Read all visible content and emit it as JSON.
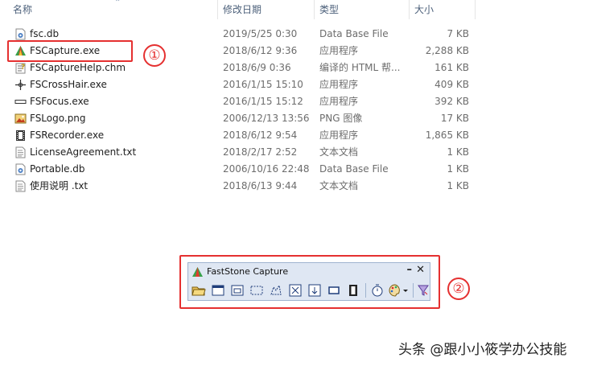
{
  "columns": {
    "name": "名称",
    "date": "修改日期",
    "type": "类型",
    "size": "大小"
  },
  "files": [
    {
      "name": "fsc.db",
      "date": "2019/5/25 0:30",
      "type": "Data Base File",
      "size": "7 KB",
      "icon": "db-file-icon"
    },
    {
      "name": "FSCapture.exe",
      "date": "2018/6/12 9:36",
      "type": "应用程序",
      "size": "2,288 KB",
      "icon": "fscapture-app-icon"
    },
    {
      "name": "FSCaptureHelp.chm",
      "date": "2018/6/9 0:36",
      "type": "编译的 HTML 帮...",
      "size": "161 KB",
      "icon": "chm-help-icon"
    },
    {
      "name": "FSCrossHair.exe",
      "date": "2016/1/15 15:10",
      "type": "应用程序",
      "size": "409 KB",
      "icon": "crosshair-icon"
    },
    {
      "name": "FSFocus.exe",
      "date": "2016/1/15 15:12",
      "type": "应用程序",
      "size": "392 KB",
      "icon": "focus-bar-icon"
    },
    {
      "name": "FSLogo.png",
      "date": "2006/12/13 13:56",
      "type": "PNG 图像",
      "size": "17 KB",
      "icon": "png-image-icon"
    },
    {
      "name": "FSRecorder.exe",
      "date": "2018/6/12 9:54",
      "type": "应用程序",
      "size": "1,865 KB",
      "icon": "film-recorder-icon"
    },
    {
      "name": "LicenseAgreement.txt",
      "date": "2018/2/17 2:52",
      "type": "文本文档",
      "size": "1 KB",
      "icon": "text-file-icon"
    },
    {
      "name": "Portable.db",
      "date": "2006/10/16 22:48",
      "type": "Data Base File",
      "size": "1 KB",
      "icon": "db-file-icon"
    },
    {
      "name": "使用说明 .txt",
      "date": "2018/6/13 9:44",
      "type": "文本文档",
      "size": "1 KB",
      "icon": "text-file-icon"
    }
  ],
  "annotations": {
    "first": "①",
    "second": "②",
    "accent": "#e53030"
  },
  "toolbar": {
    "title": "FastStone Capture",
    "minimize": "–",
    "close": "✕"
  },
  "watermark": "头条 @跟小小筱学办公技能"
}
